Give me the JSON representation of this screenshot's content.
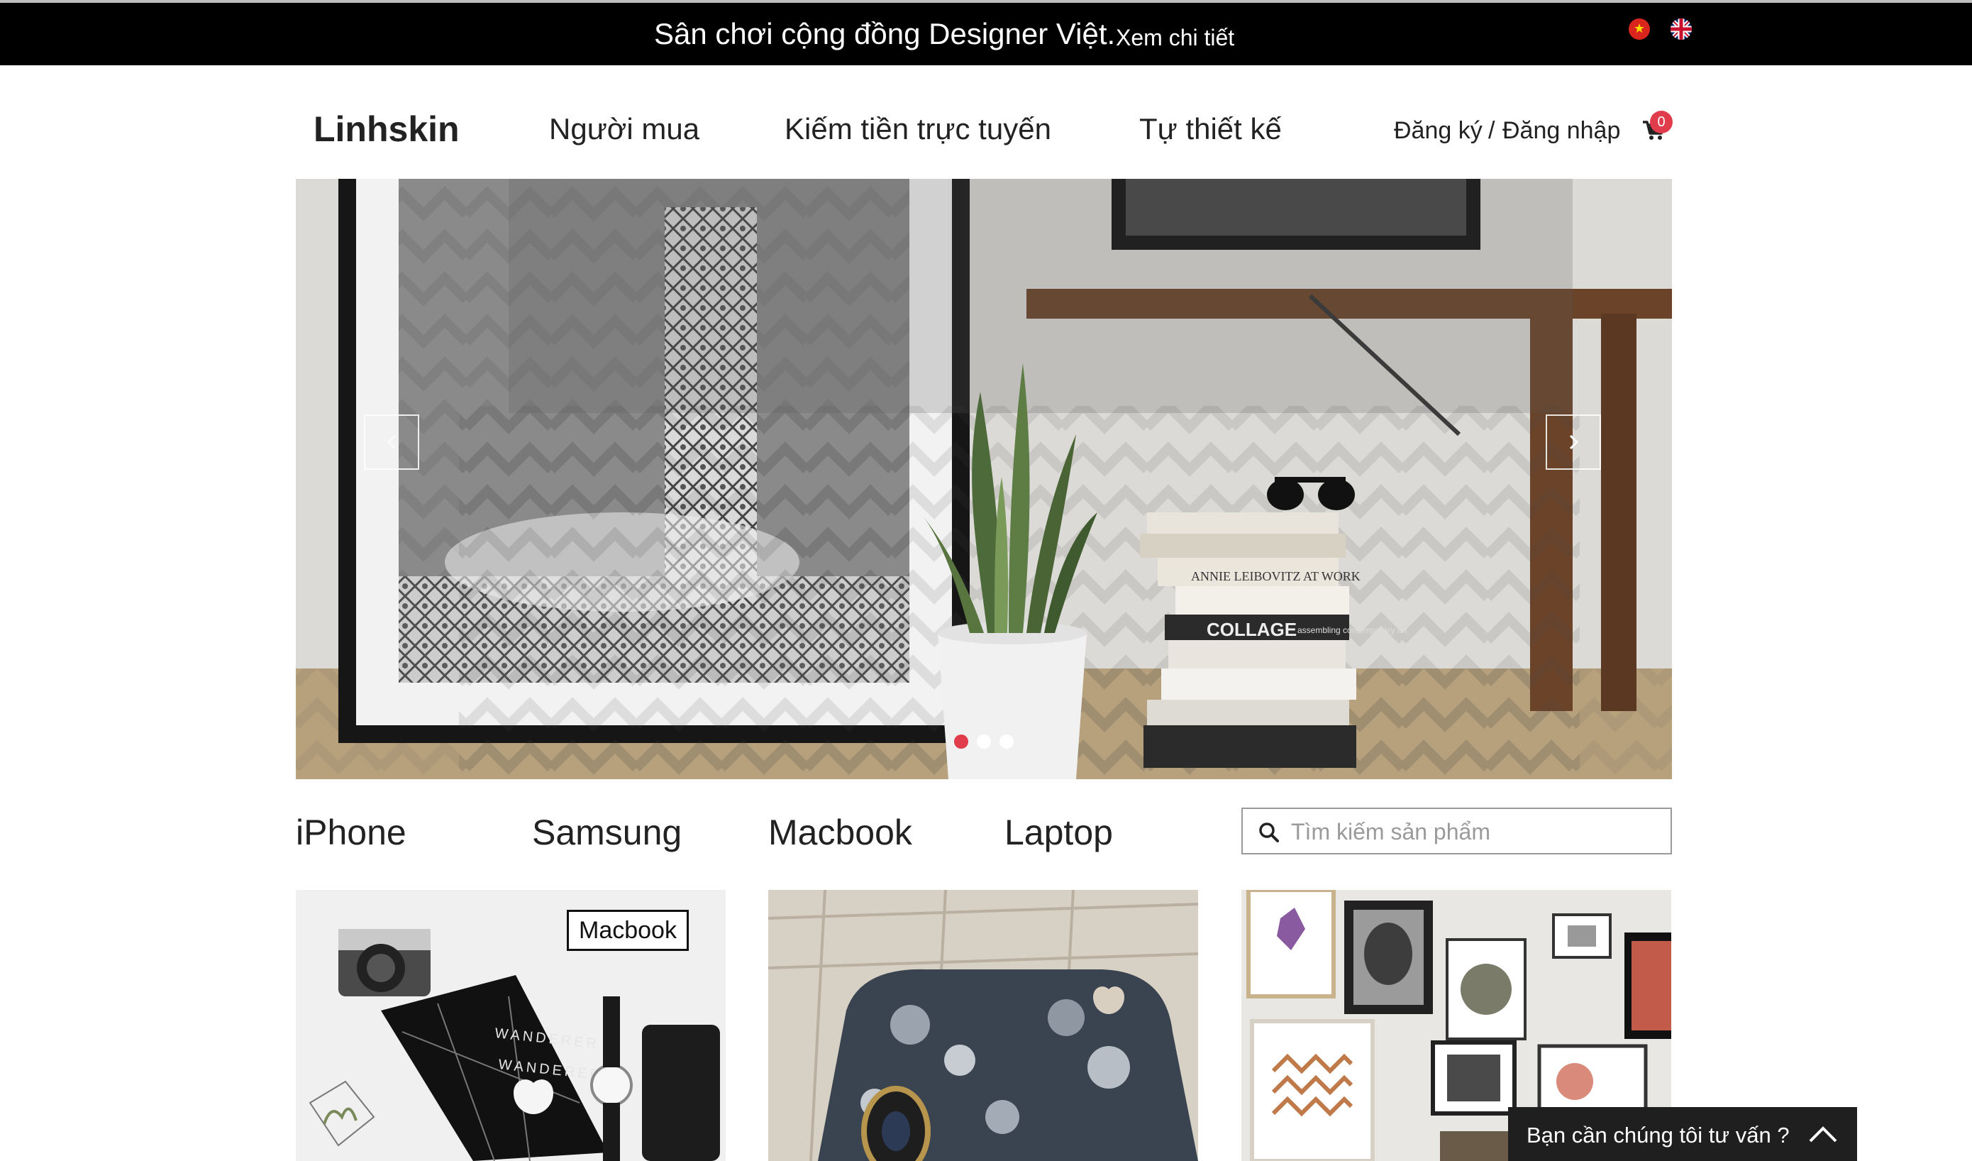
{
  "announcement": {
    "message": "Sân chơi cộng đồng Designer Việt.",
    "link_label": "Xem chi tiết",
    "languages": [
      {
        "code": "vi",
        "icon": "vietnam-flag-icon"
      },
      {
        "code": "en",
        "icon": "uk-flag-icon"
      }
    ]
  },
  "header": {
    "brand": "Linhskin",
    "nav": [
      {
        "label": "Người mua"
      },
      {
        "label": "Kiếm tiền trực tuyến"
      },
      {
        "label": "Tự thiết kế"
      }
    ],
    "register_label": "Đăng ký",
    "separator": "/",
    "login_label": "Đăng nhập",
    "cart_icon": "shopping-cart-icon",
    "cart_count": "0"
  },
  "slider": {
    "prev_icon": "chevron-left-icon",
    "next_icon": "chevron-right-icon",
    "slide_count": 3,
    "active_slide": 1,
    "book_titles": [
      "ANNIE LEIBOVITZ AT WORK",
      "COLLAGE",
      "assembling contemporary art"
    ]
  },
  "categories": [
    {
      "label": "iPhone"
    },
    {
      "label": "Samsung"
    },
    {
      "label": "Macbook"
    },
    {
      "label": "Laptop"
    }
  ],
  "search": {
    "icon": "search-icon",
    "placeholder": "Tìm kiếm sản phẩm",
    "value": ""
  },
  "products": [
    {
      "tag": "Macbook",
      "skin_text": "WANDERER"
    },
    {
      "tag": ""
    },
    {
      "tag": ""
    }
  ],
  "chat": {
    "label": "Bạn cần chúng tôi tư vấn ?",
    "icon": "chevron-up-icon"
  },
  "colors": {
    "announcement_bg": "#000000",
    "accent": "#e03c4c",
    "chat_bg": "#1f1f1f"
  }
}
